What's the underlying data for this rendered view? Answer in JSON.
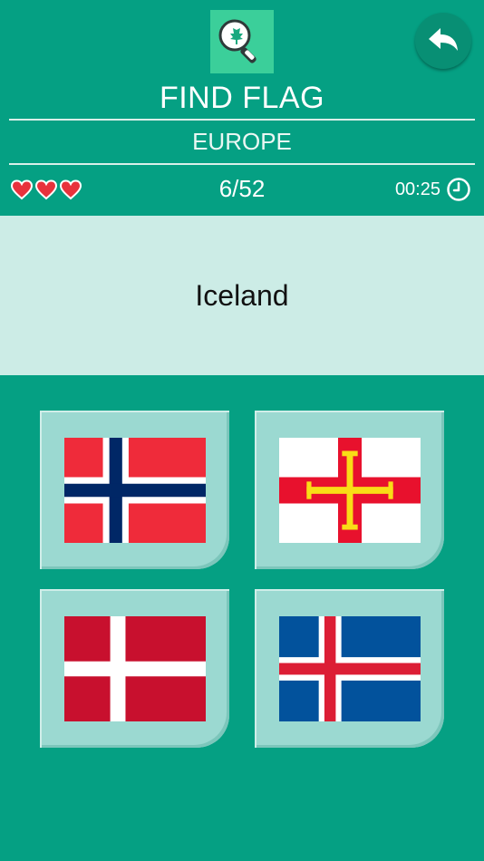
{
  "header": {
    "title": "FIND FLAG",
    "subtitle": "EUROPE",
    "logo_icon": "magnifier-maple-leaf-icon",
    "back_icon": "back-arrow-icon"
  },
  "status": {
    "lives": 3,
    "progress": "6/52",
    "timer": "00:25"
  },
  "question": {
    "country": "Iceland"
  },
  "options": [
    {
      "flag": "norway-flag"
    },
    {
      "flag": "guernsey-flag"
    },
    {
      "flag": "denmark-flag"
    },
    {
      "flag": "iceland-flag"
    }
  ],
  "colors": {
    "background": "#05a083",
    "panel": "#ccece6",
    "card": "#9bd9d1",
    "heart": "#e8323c"
  }
}
